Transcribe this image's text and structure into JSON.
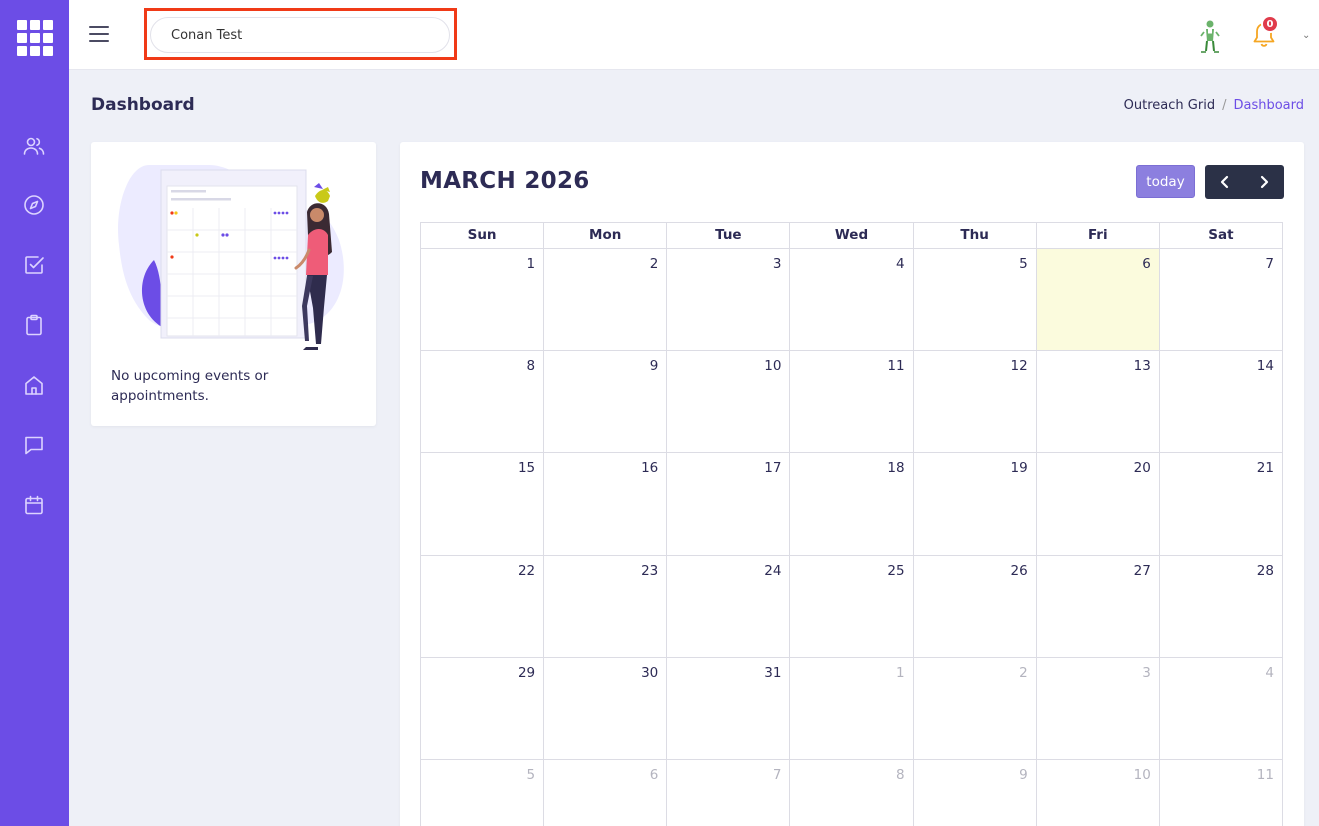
{
  "topbar": {
    "search_value": "Conan Test",
    "notification_count": "0"
  },
  "sidebar": {
    "items": [
      {
        "icon": "users-icon"
      },
      {
        "icon": "compass-icon"
      },
      {
        "icon": "checkbox-icon"
      },
      {
        "icon": "clipboard-icon"
      },
      {
        "icon": "home-icon"
      },
      {
        "icon": "chat-icon"
      },
      {
        "icon": "calendar-icon"
      }
    ]
  },
  "page": {
    "title": "Dashboard",
    "breadcrumb": [
      "Outreach Grid",
      "Dashboard"
    ]
  },
  "events": {
    "empty_message": "No upcoming events or appointments."
  },
  "calendar": {
    "title": "MARCH 2026",
    "today_label": "today",
    "weekdays": [
      "Sun",
      "Mon",
      "Tue",
      "Wed",
      "Thu",
      "Fri",
      "Sat"
    ],
    "weeks": [
      [
        {
          "d": "1"
        },
        {
          "d": "2"
        },
        {
          "d": "3"
        },
        {
          "d": "4"
        },
        {
          "d": "5"
        },
        {
          "d": "6",
          "today": true
        },
        {
          "d": "7"
        }
      ],
      [
        {
          "d": "8"
        },
        {
          "d": "9"
        },
        {
          "d": "10"
        },
        {
          "d": "11"
        },
        {
          "d": "12"
        },
        {
          "d": "13"
        },
        {
          "d": "14"
        }
      ],
      [
        {
          "d": "15"
        },
        {
          "d": "16"
        },
        {
          "d": "17"
        },
        {
          "d": "18"
        },
        {
          "d": "19"
        },
        {
          "d": "20"
        },
        {
          "d": "21"
        }
      ],
      [
        {
          "d": "22"
        },
        {
          "d": "23"
        },
        {
          "d": "24"
        },
        {
          "d": "25"
        },
        {
          "d": "26"
        },
        {
          "d": "27"
        },
        {
          "d": "28"
        }
      ],
      [
        {
          "d": "29"
        },
        {
          "d": "30"
        },
        {
          "d": "31"
        },
        {
          "d": "1",
          "other": true
        },
        {
          "d": "2",
          "other": true
        },
        {
          "d": "3",
          "other": true
        },
        {
          "d": "4",
          "other": true
        }
      ],
      [
        {
          "d": "5",
          "other": true
        },
        {
          "d": "6",
          "other": true
        },
        {
          "d": "7",
          "other": true
        },
        {
          "d": "8",
          "other": true
        },
        {
          "d": "9",
          "other": true
        },
        {
          "d": "10",
          "other": true
        },
        {
          "d": "11",
          "other": true
        }
      ]
    ]
  },
  "colors": {
    "sidebar": "#6c4de6",
    "accent": "#6c4de6",
    "today_cell": "#fbfbdd",
    "today_button": "#8c7fdf",
    "nav_buttons": "#2b3147",
    "highlight_border": "#f03a17",
    "badge": "#e03b4b"
  }
}
